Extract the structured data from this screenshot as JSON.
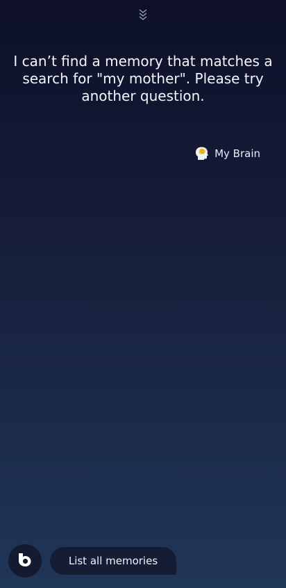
{
  "header": {
    "collapse_icon": "chevrons-down-icon"
  },
  "response": {
    "text": "I can’t find a memory that matches a search for \"my mother\". Please try another question."
  },
  "source": {
    "icon": "brain-head-icon",
    "label": "My Brain"
  },
  "bottom": {
    "assistant_icon": "bixby-icon",
    "suggestion_label": "List all memories"
  },
  "colors": {
    "background_top": "#0d1028",
    "background_bottom": "#203658",
    "chip_background": "#141d33"
  }
}
